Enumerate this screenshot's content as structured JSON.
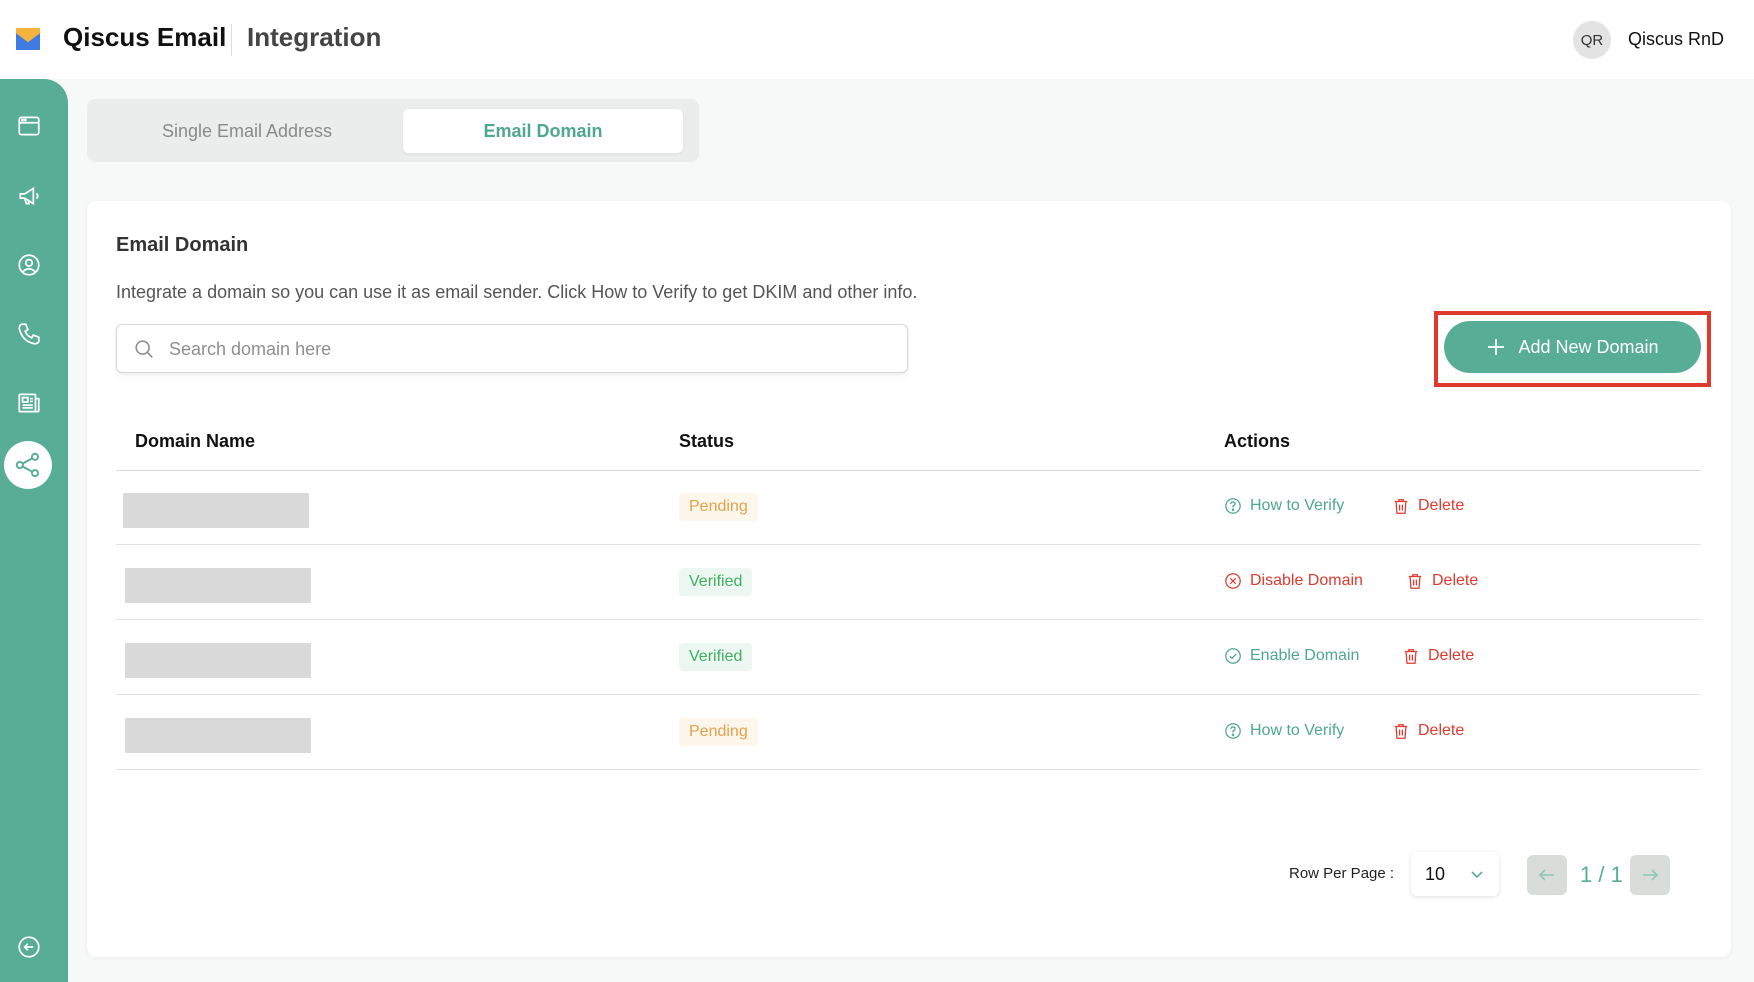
{
  "header": {
    "app_title": "Qiscus Email",
    "page_title": "Integration",
    "avatar_initials": "QR",
    "user_name": "Qiscus RnD"
  },
  "sidebar": {
    "items": [
      {
        "icon": "browser-window-icon"
      },
      {
        "icon": "megaphone-icon"
      },
      {
        "icon": "user-circle-icon"
      },
      {
        "icon": "phone-icon"
      },
      {
        "icon": "newspaper-icon"
      },
      {
        "icon": "share-nodes-icon",
        "active": true
      }
    ],
    "collapse_icon": "arrow-left-circle-icon"
  },
  "tabs": [
    {
      "label": "Single Email Address",
      "active": false
    },
    {
      "label": "Email Domain",
      "active": true
    }
  ],
  "card": {
    "title": "Email Domain",
    "description": "Integrate a domain so you can use it as email sender. Click How to Verify to get DKIM and other info.",
    "search_placeholder": "Search domain here",
    "add_button_label": "Add New Domain"
  },
  "table": {
    "headers": [
      "Domain Name",
      "Status",
      "Actions"
    ],
    "rows": [
      {
        "status": "Pending",
        "action": "How to Verify",
        "delete": "Delete"
      },
      {
        "status": "Verified",
        "action": "Disable Domain",
        "delete": "Delete"
      },
      {
        "status": "Verified",
        "action": "Enable Domain",
        "delete": "Delete"
      },
      {
        "status": "Pending",
        "action": "How to Verify",
        "delete": "Delete"
      }
    ]
  },
  "pagination": {
    "rows_per_page_label": "Row Per Page :",
    "rows_per_page_value": "10",
    "page_info": "1 / 1"
  },
  "colors": {
    "brand_green": "#57ad96",
    "danger_red": "#e03a2f",
    "pending_orange": "#e3a24d",
    "verified_green": "#3fae60"
  }
}
